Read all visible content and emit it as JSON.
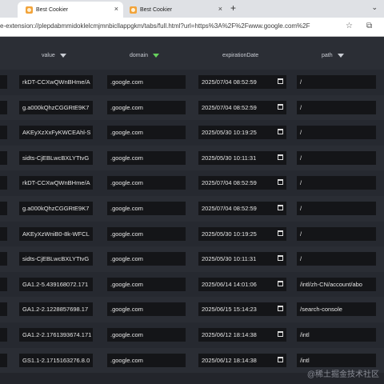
{
  "browser": {
    "tabs": [
      {
        "title": "Best Cookier",
        "active": true
      },
      {
        "title": "Best Cookier",
        "active": false
      }
    ],
    "close_glyph": "×",
    "new_tab_glyph": "+",
    "tab_menu_glyph": "⌄",
    "url": "e-extension://plepdabmmidoklelcmjmnbicllappgkm/tabs/full.html?url=https%3A%2F%2Fwww.google.com%2F",
    "icons": [
      "bookmark-star-icon",
      "extensions-icon"
    ]
  },
  "table": {
    "columns": {
      "value": "value",
      "domain": "domain",
      "expiration": "expirationDate",
      "path": "path"
    },
    "rows": [
      {
        "value": "rkDT-CCXwQWnBHme/A",
        "domain": ".google.com",
        "expiration": "2025/07/04 08:52:59",
        "path": "/"
      },
      {
        "value": "g.a000kQhzCGGRtE9K7",
        "domain": ".google.com",
        "expiration": "2025/07/04 08:52:59",
        "path": "/"
      },
      {
        "value": "AKEyXzXxFyKWCEAhl-S",
        "domain": ".google.com",
        "expiration": "2025/05/30 10:19:25",
        "path": "/"
      },
      {
        "value": "sidts-CjEBLwcBXLYTtvG",
        "domain": ".google.com",
        "expiration": "2025/05/30 10:11:31",
        "path": "/"
      },
      {
        "value": "rkDT-CCXwQWnBHme/A",
        "domain": ".google.com",
        "expiration": "2025/07/04 08:52:59",
        "path": "/"
      },
      {
        "value": "g.a000kQhzCGGRtE9K7",
        "domain": ".google.com",
        "expiration": "2025/07/04 08:52:59",
        "path": "/"
      },
      {
        "value": "AKEyXzWniB0-8k-WFCL",
        "domain": ".google.com",
        "expiration": "2025/05/30 10:19:25",
        "path": "/"
      },
      {
        "value": "sidts-CjEBLwcBXLYTtvG",
        "domain": ".google.com",
        "expiration": "2025/05/30 10:11:31",
        "path": "/"
      },
      {
        "value": "GA1.2-5.439168072.171",
        "domain": ".google.com",
        "expiration": "2025/06/14 14:01:06",
        "path": "/intl/zh-CN/account/abo"
      },
      {
        "value": "GA1.2-2.1228857698.17",
        "domain": ".google.com",
        "expiration": "2025/06/15 15:14:23",
        "path": "/search-console"
      },
      {
        "value": "GA1.2-2.1761393674.171",
        "domain": ".google.com",
        "expiration": "2025/06/12 18:14:38",
        "path": "/intl"
      },
      {
        "value": "GS1.1-2.1715163276.8.0",
        "domain": ".google.com",
        "expiration": "2025/06/12 18:14:38",
        "path": "/intl"
      }
    ]
  },
  "watermark": "@稀土掘金技术社区"
}
